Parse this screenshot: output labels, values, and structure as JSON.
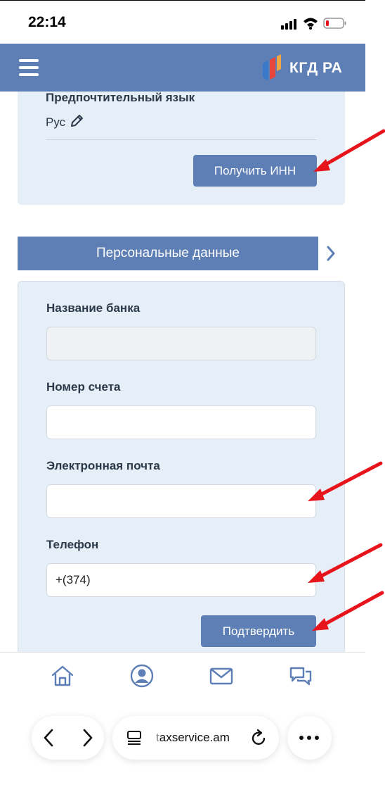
{
  "status_bar": {
    "time": "22:14"
  },
  "app_bar": {
    "brand": "КГД РА",
    "menu_icon": "hamburger-icon",
    "logo_icon": "kgd-logo-icon"
  },
  "settings_card": {
    "language_title": "Предпочтительный язык",
    "language_value": "Рус",
    "get_inn_button": "Получить ИНН"
  },
  "section": {
    "title": "Персональные данные"
  },
  "form": {
    "bank_name_label": "Название банка",
    "bank_name_value": "",
    "account_label": "Номер счета",
    "account_value": "",
    "email_label": "Электронная почта",
    "email_value": "",
    "phone_label": "Телефон",
    "phone_value": "+(374)",
    "confirm_button": "Подтвердить"
  },
  "tab_bar": {
    "items": [
      "home-icon",
      "profile-icon",
      "mail-icon",
      "chat-icon"
    ]
  },
  "browser": {
    "url_first": "t",
    "url_rest": "axservice.am"
  },
  "colors": {
    "accent": "#5d7fb6",
    "card_bg": "#e6eef7",
    "annotation_arrow": "#e8141b"
  }
}
